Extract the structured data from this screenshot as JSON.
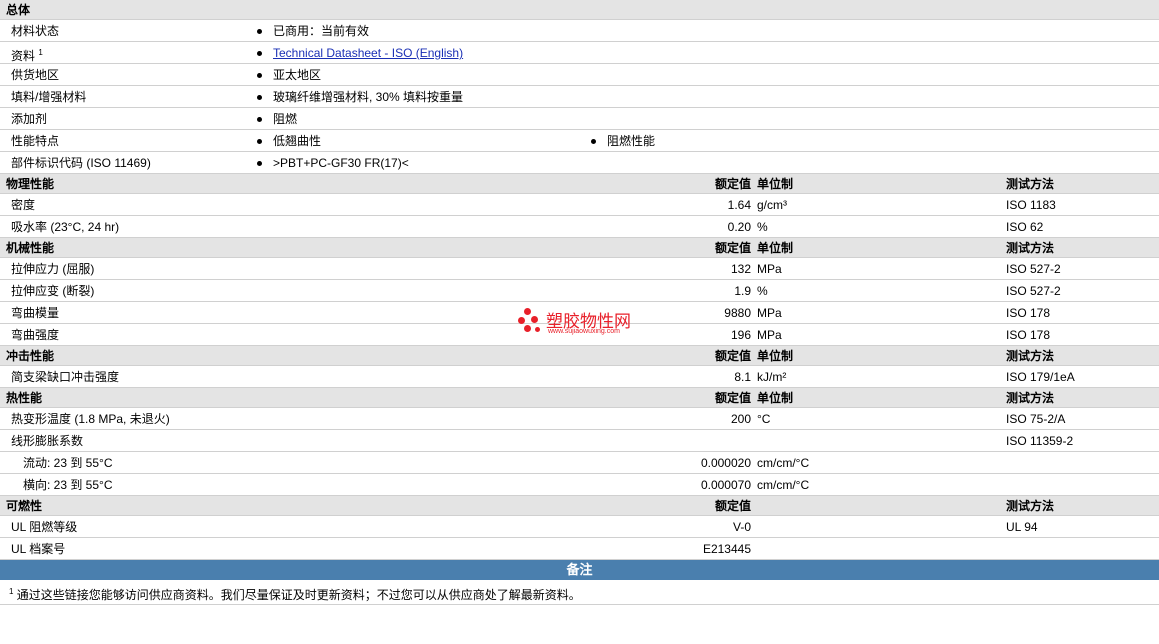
{
  "general": {
    "title": "总体",
    "material_status": {
      "label": "材料状态",
      "value": "已商用：当前有效"
    },
    "literature": {
      "label": "资料",
      "sup": "1",
      "link": "Technical Datasheet - ISO (English)"
    },
    "availability": {
      "label": "供货地区",
      "value": "亚太地区"
    },
    "filler": {
      "label": "填料/增强材料",
      "value": "玻璃纤维增强材料, 30% 填料按重量"
    },
    "additive": {
      "label": "添加剂",
      "value": "阻燃"
    },
    "features": {
      "label": "性能特点",
      "values": [
        "低翘曲性",
        "阻燃性能"
      ]
    },
    "part_marking": {
      "label": "部件标识代码 (ISO 11469)",
      "value": ">PBT+PC-GF30 FR(17)<"
    }
  },
  "physical": {
    "title": "物理性能",
    "col_value": "额定值",
    "col_unit": "单位制",
    "col_test": "测试方法",
    "rows": [
      {
        "label": "密度",
        "value": "1.64",
        "unit": "g/cm³",
        "test": "ISO 1183"
      },
      {
        "label": "吸水率 (23°C, 24 hr)",
        "value": "0.20",
        "unit": "%",
        "test": "ISO 62"
      }
    ]
  },
  "mechanical": {
    "title": "机械性能",
    "col_value": "额定值",
    "col_unit": "单位制",
    "col_test": "测试方法",
    "rows": [
      {
        "label": "拉伸应力 (屈服)",
        "value": "132",
        "unit": "MPa",
        "test": "ISO 527-2"
      },
      {
        "label": "拉伸应变 (断裂)",
        "value": "1.9",
        "unit": "%",
        "test": "ISO 527-2"
      },
      {
        "label": "弯曲模量",
        "value": "9880",
        "unit": "MPa",
        "test": "ISO 178"
      },
      {
        "label": "弯曲强度",
        "value": "196",
        "unit": "MPa",
        "test": "ISO 178"
      }
    ]
  },
  "impact": {
    "title": "冲击性能",
    "col_value": "额定值",
    "col_unit": "单位制",
    "col_test": "测试方法",
    "rows": [
      {
        "label": "简支梁缺口冲击强度",
        "value": "8.1",
        "unit": "kJ/m²",
        "test": "ISO 179/1eA"
      }
    ]
  },
  "thermal": {
    "title": "热性能",
    "col_value": "额定值",
    "col_unit": "单位制",
    "col_test": "测试方法",
    "hdt": {
      "label": "热变形温度 (1.8 MPa, 未退火)",
      "value": "200",
      "unit": "°C",
      "test": "ISO 75-2/A"
    },
    "clte": {
      "label": "线形膨胀系数",
      "test": "ISO 11359-2"
    },
    "flow": {
      "label": "流动: 23 到  55°C",
      "value": "0.000020",
      "unit": "cm/cm/°C"
    },
    "transverse": {
      "label": "横向: 23 到  55°C",
      "value": "0.000070",
      "unit": "cm/cm/°C"
    }
  },
  "flammability": {
    "title": "可燃性",
    "col_value": "额定值",
    "col_test": "测试方法",
    "rows": [
      {
        "label": "UL 阻燃等级",
        "value": "V-0",
        "test": "UL 94"
      },
      {
        "label": "UL 档案号",
        "value": "E213445",
        "test": ""
      }
    ]
  },
  "notes": {
    "title": "备注",
    "sup": "1",
    "text": "通过这些链接您能够访问供应商资料。我们尽量保证及时更新资料；不过您可以从供应商处了解最新资料。"
  },
  "watermark": {
    "name": "塑胶物性网",
    "url": "www.sujiaowuxing.com",
    "color": "#e8202a"
  }
}
